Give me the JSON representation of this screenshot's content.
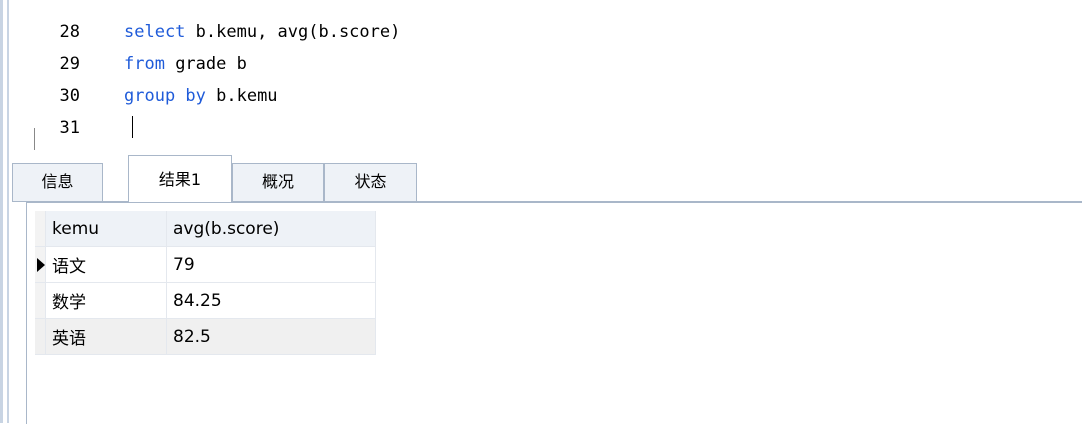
{
  "editor": {
    "lines": [
      {
        "num": "28",
        "kw1": "select",
        "rest": " b.kemu, avg(b.score)"
      },
      {
        "num": "29",
        "kw1": "from",
        "rest": " grade b"
      },
      {
        "num": "30",
        "kw1": "group by",
        "rest": " b.kemu"
      },
      {
        "num": "31",
        "kw1": "",
        "rest": ""
      }
    ]
  },
  "tabs": [
    "信息",
    "结果1",
    "概况",
    "状态"
  ],
  "grid": {
    "headers": [
      "kemu",
      "avg(b.score)"
    ],
    "rows": [
      [
        "语文",
        "79"
      ],
      [
        "数学",
        "84.25"
      ],
      [
        "英语",
        "82.5"
      ]
    ]
  },
  "colors": {
    "keyword": "#1f5bd9",
    "tab_bg": "#eef2f7",
    "border": "#a9b7c9"
  }
}
